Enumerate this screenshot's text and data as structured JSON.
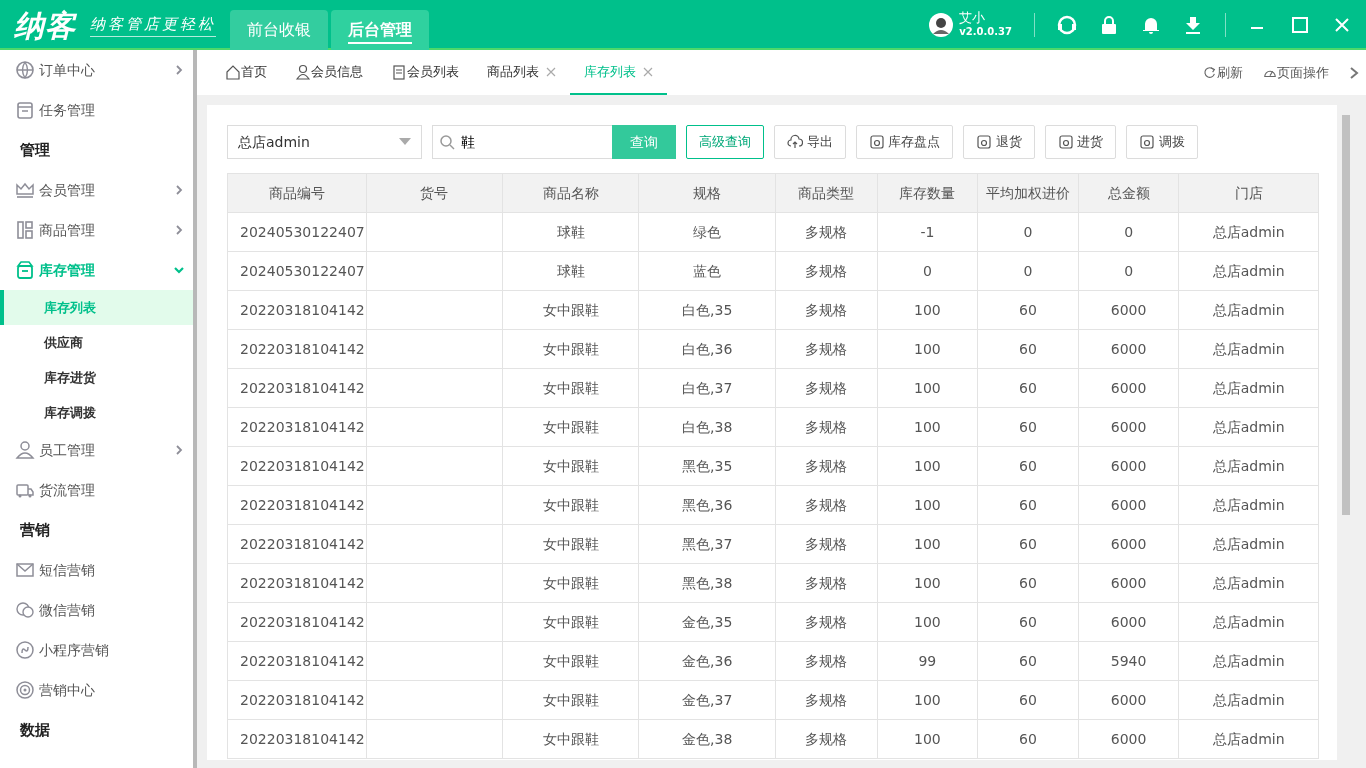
{
  "header": {
    "logo": "纳客",
    "slogan": "纳客管店更轻松",
    "modes": [
      {
        "label": "前台收银",
        "selected": false
      },
      {
        "label": "后台管理",
        "selected": true
      }
    ],
    "user": {
      "name": "艾小",
      "version": "v2.0.0.37"
    }
  },
  "sidebar": {
    "items": [
      {
        "kind": "item",
        "label": "订单中心",
        "has_submenu": true,
        "expanded": false
      },
      {
        "kind": "item",
        "label": "任务管理",
        "has_submenu": false,
        "expanded": false
      },
      {
        "kind": "section",
        "label": "管理"
      },
      {
        "kind": "item",
        "label": "会员管理",
        "has_submenu": true,
        "expanded": false
      },
      {
        "kind": "item",
        "label": "商品管理",
        "has_submenu": true,
        "expanded": false
      },
      {
        "kind": "item",
        "label": "库存管理",
        "has_submenu": true,
        "expanded": true,
        "children": [
          {
            "label": "库存列表",
            "selected": true
          },
          {
            "label": "供应商",
            "selected": false
          },
          {
            "label": "库存进货",
            "selected": false
          },
          {
            "label": "库存调拨",
            "selected": false
          }
        ]
      },
      {
        "kind": "item",
        "label": "员工管理",
        "has_submenu": true,
        "expanded": false
      },
      {
        "kind": "item",
        "label": "货流管理",
        "has_submenu": false,
        "expanded": false
      },
      {
        "kind": "section",
        "label": "营销"
      },
      {
        "kind": "item",
        "label": "短信营销",
        "has_submenu": false,
        "expanded": false
      },
      {
        "kind": "item",
        "label": "微信营销",
        "has_submenu": false,
        "expanded": false
      },
      {
        "kind": "item",
        "label": "小程序营销",
        "has_submenu": false,
        "expanded": false
      },
      {
        "kind": "item",
        "label": "营销中心",
        "has_submenu": false,
        "expanded": false
      },
      {
        "kind": "section",
        "label": "数据"
      }
    ]
  },
  "tabs": [
    {
      "label": "首页",
      "selected": false,
      "closable": false
    },
    {
      "label": "会员信息",
      "selected": false,
      "closable": false
    },
    {
      "label": "会员列表",
      "selected": false,
      "closable": false
    },
    {
      "label": "商品列表",
      "selected": false,
      "closable": true
    },
    {
      "label": "库存列表",
      "selected": true,
      "closable": true
    }
  ],
  "tab_actions": [
    "刷新",
    "页面操作"
  ],
  "toolbar": {
    "store": "总店admin",
    "search": "鞋",
    "search_button": "查询",
    "buttons": [
      {
        "label": "高级查询",
        "kind": "outline"
      },
      {
        "label": "导出",
        "kind": "plain"
      },
      {
        "label": "库存盘点",
        "kind": "plain"
      },
      {
        "label": "退货",
        "kind": "plain"
      },
      {
        "label": "进货",
        "kind": "plain"
      },
      {
        "label": "调拨",
        "kind": "plain"
      }
    ]
  },
  "table": {
    "columns": [
      "商品编号",
      "货号",
      "商品名称",
      "规格",
      "商品类型",
      "库存数量",
      "平均加权进价",
      "总金额",
      "门店"
    ],
    "rows": [
      [
        "20240530122407",
        "",
        "球鞋",
        "绿色",
        "多规格",
        "-1",
        "0",
        "0",
        "总店admin"
      ],
      [
        "20240530122407",
        "",
        "球鞋",
        "蓝色",
        "多规格",
        "0",
        "0",
        "0",
        "总店admin"
      ],
      [
        "20220318104142",
        "",
        "女中跟鞋",
        "白色,35",
        "多规格",
        "100",
        "60",
        "6000",
        "总店admin"
      ],
      [
        "20220318104142",
        "",
        "女中跟鞋",
        "白色,36",
        "多规格",
        "100",
        "60",
        "6000",
        "总店admin"
      ],
      [
        "20220318104142",
        "",
        "女中跟鞋",
        "白色,37",
        "多规格",
        "100",
        "60",
        "6000",
        "总店admin"
      ],
      [
        "20220318104142",
        "",
        "女中跟鞋",
        "白色,38",
        "多规格",
        "100",
        "60",
        "6000",
        "总店admin"
      ],
      [
        "20220318104142",
        "",
        "女中跟鞋",
        "黑色,35",
        "多规格",
        "100",
        "60",
        "6000",
        "总店admin"
      ],
      [
        "20220318104142",
        "",
        "女中跟鞋",
        "黑色,36",
        "多规格",
        "100",
        "60",
        "6000",
        "总店admin"
      ],
      [
        "20220318104142",
        "",
        "女中跟鞋",
        "黑色,37",
        "多规格",
        "100",
        "60",
        "6000",
        "总店admin"
      ],
      [
        "20220318104142",
        "",
        "女中跟鞋",
        "黑色,38",
        "多规格",
        "100",
        "60",
        "6000",
        "总店admin"
      ],
      [
        "20220318104142",
        "",
        "女中跟鞋",
        "金色,35",
        "多规格",
        "100",
        "60",
        "6000",
        "总店admin"
      ],
      [
        "20220318104142",
        "",
        "女中跟鞋",
        "金色,36",
        "多规格",
        "99",
        "60",
        "5940",
        "总店admin"
      ],
      [
        "20220318104142",
        "",
        "女中跟鞋",
        "金色,37",
        "多规格",
        "100",
        "60",
        "6000",
        "总店admin"
      ],
      [
        "20220318104142",
        "",
        "女中跟鞋",
        "金色,38",
        "多规格",
        "100",
        "60",
        "6000",
        "总店admin"
      ]
    ]
  }
}
